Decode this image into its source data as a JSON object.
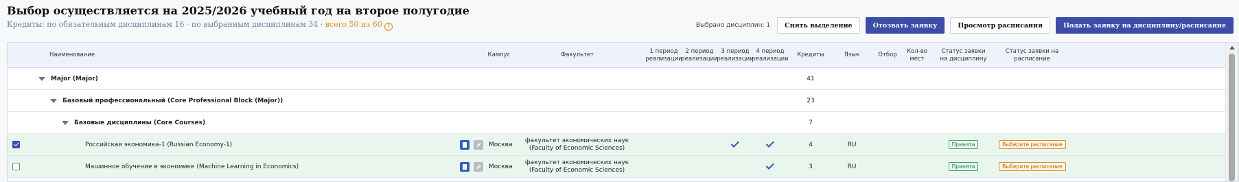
{
  "header": {
    "title": "Выбор осуществляется на 2025/2026 учебный год на второе полугодие",
    "credits_text": "Кредиты: по обязательным дисциплинам 16 · по выбранным дисциплинам 34 ·",
    "credits_total": "всего 50 из 60",
    "warning_glyph": "!"
  },
  "toolbar": {
    "selected_count": "Выбрано дисциплин: 1",
    "clear_selection": "Снять выделение",
    "withdraw": "Отозвать заявку",
    "view_schedule": "Просмотр расписания",
    "submit": "Подать заявку на дисциплину/расписание"
  },
  "table": {
    "columns": {
      "name": "Наименование",
      "campus": "Кампус",
      "faculty": "Факультет",
      "p1": "1 период реализации",
      "p2": "2 период реализации",
      "p3": "3 период реализации",
      "p4": "4 период реализации",
      "credits": "Кредиты",
      "language": "Язык",
      "selection": "Отбор",
      "seats": "Кол-во мест",
      "status_discipline": "Статус заявки на дисциплину",
      "status_schedule": "Статус заявки на расписание"
    },
    "groups": [
      {
        "label": "Major (Major)",
        "credits": "41"
      },
      {
        "label": "Базовый профессиональный (Core Professional Block (Major))",
        "credits": "23"
      },
      {
        "label": "Базовые дисциплины (Core Courses)",
        "credits": "7"
      }
    ],
    "rows": [
      {
        "checked": true,
        "name": "Российская экономика-1 (Russian Economy-1)",
        "campus": "Москва",
        "faculty": "факультет экономических наук (Faculty of Economic Sciences)",
        "p3": true,
        "p4": true,
        "credits": "4",
        "language": "RU",
        "status_discipline": "Принята",
        "status_schedule": "Выберите расписание"
      },
      {
        "checked": false,
        "name": "Машинное обучение в экономике (Machine Learning in Economics)",
        "campus": "Москва",
        "faculty": "факультет экономических наук (Faculty of Economic Sciences)",
        "p3": false,
        "p4": true,
        "credits": "3",
        "language": "RU",
        "status_discipline": "Принята",
        "status_schedule": "Выберите расписание"
      }
    ]
  },
  "colors": {
    "primary": "#3c4da8",
    "accent_orange": "#e08a1a",
    "selected_row": "#e9f6ee",
    "accepted_green": "#3aa56a"
  }
}
